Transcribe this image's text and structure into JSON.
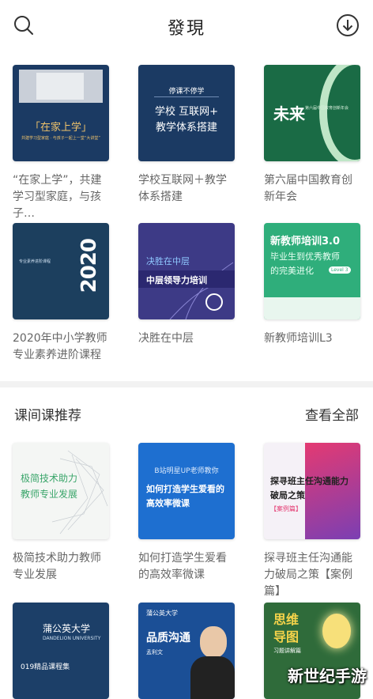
{
  "header": {
    "title": "發現"
  },
  "colors": {
    "navy": "#1b3a63",
    "blue": "#1e6fd0",
    "green": "#1a6b45",
    "lightgreen": "#bfe6c7",
    "purple": "#3d3a86",
    "pink": "#e43a72"
  },
  "cards": [
    {
      "caption": "“在家上学”，共建学习型家庭，与孩子…",
      "thumb_title": "「在家上学」",
      "thumb_sub": "共建学习型家庭 · 与孩子一起上一堂“大讲堂”"
    },
    {
      "caption": "学校互联网＋教学体系搭建",
      "thumb_top": "停课不停学",
      "thumb_l1": "学校 互联网+",
      "thumb_l2": "教学体系搭建"
    },
    {
      "caption": "第六届中国教育创新年会",
      "thumb_main": "未来",
      "thumb_small": "第六届中国教育创新年会"
    },
    {
      "caption": "2020年中小学教师专业素养进阶课程",
      "thumb_year": "2020",
      "thumb_small": "专业素养进阶课程"
    },
    {
      "caption": "决胜在中层",
      "thumb_l1": "决胜在中层",
      "thumb_l2": "中层领导力培训"
    },
    {
      "caption": "新教师培训L3",
      "thumb_l1": "新教师培训3.0",
      "thumb_l2": "毕业生到优秀教师",
      "thumb_l3": "的完美进化",
      "thumb_badge": "Level 3"
    },
    {
      "caption": "极简技术助力教师专业发展",
      "thumb_l1": "极简技术助力",
      "thumb_l2": "教师专业发展"
    },
    {
      "caption": "如何打造学生爱看的高效率微课",
      "thumb_top": "B站明星UP老师教你",
      "thumb_l1": "如何打造学生爱看的",
      "thumb_l2": "高效率微课"
    },
    {
      "caption": "探寻班主任沟通能力破局之策【案例篇】",
      "thumb_l1": "探寻班主任沟通能力",
      "thumb_l2": "破局之策",
      "thumb_tag": "【案例篇】"
    },
    {
      "caption": "",
      "thumb_l1": "蒲公英大学",
      "thumb_l2": "DANDELION UNIVERSITY",
      "thumb_l3": "019精品课程集"
    },
    {
      "caption": "",
      "thumb_top": "蒲公英大学",
      "thumb_l1": "品质沟通",
      "thumb_name": "孟利文"
    },
    {
      "caption": "",
      "thumb_l1": "思维",
      "thumb_l2": "导图",
      "thumb_small": "习题讲解篇"
    }
  ],
  "section": {
    "title": "课间课推荐",
    "more": "查看全部"
  },
  "watermark": "新世纪手游"
}
